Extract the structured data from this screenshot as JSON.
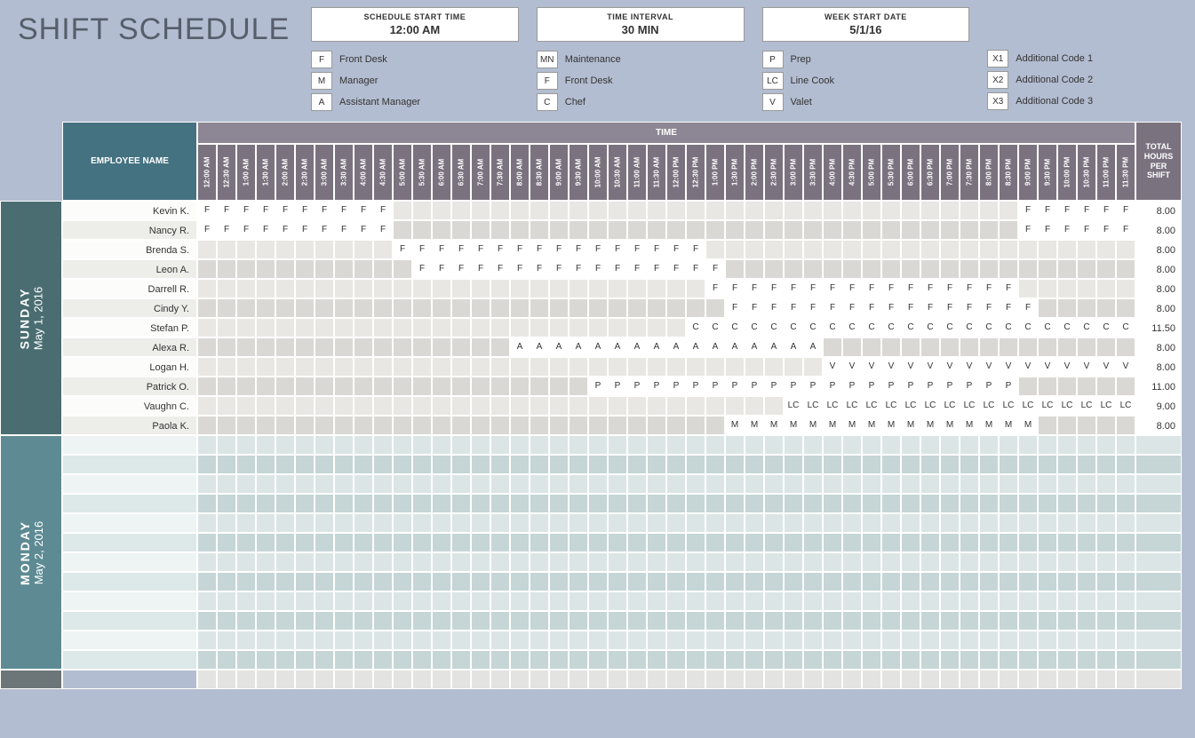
{
  "title": "SHIFT SCHEDULE",
  "info": [
    {
      "label": "SCHEDULE START TIME",
      "value": "12:00 AM"
    },
    {
      "label": "TIME INTERVAL",
      "value": "30 MIN"
    },
    {
      "label": "WEEK START DATE",
      "value": "5/1/16"
    }
  ],
  "legend": [
    [
      {
        "code": "F",
        "text": "Front Desk"
      },
      {
        "code": "M",
        "text": "Manager"
      },
      {
        "code": "A",
        "text": "Assistant Manager"
      }
    ],
    [
      {
        "code": "MN",
        "text": "Maintenance"
      },
      {
        "code": "F",
        "text": "Front Desk"
      },
      {
        "code": "C",
        "text": "Chef"
      }
    ],
    [
      {
        "code": "P",
        "text": "Prep"
      },
      {
        "code": "LC",
        "text": "Line Cook"
      },
      {
        "code": "V",
        "text": "Valet"
      }
    ],
    [
      {
        "code": "X1",
        "text": "Additional Code 1"
      },
      {
        "code": "X2",
        "text": "Additional Code 2"
      },
      {
        "code": "X3",
        "text": "Additional Code 3"
      }
    ]
  ],
  "headers": {
    "employee": "EMPLOYEE NAME",
    "time": "TIME",
    "total": "TOTAL HOURS PER SHIFT"
  },
  "time_slots": [
    "12:00 AM",
    "12:30 AM",
    "1:00 AM",
    "1:30 AM",
    "2:00 AM",
    "2:30 AM",
    "3:00 AM",
    "3:30 AM",
    "4:00 AM",
    "4:30 AM",
    "5:00 AM",
    "5:30 AM",
    "6:00 AM",
    "6:30 AM",
    "7:00 AM",
    "7:30 AM",
    "8:00 AM",
    "8:30 AM",
    "9:00 AM",
    "9:30 AM",
    "10:00 AM",
    "10:30 AM",
    "11:00 AM",
    "11:30 AM",
    "12:00 PM",
    "12:30 PM",
    "1:00 PM",
    "1:30 PM",
    "2:00 PM",
    "2:30 PM",
    "3:00 PM",
    "3:30 PM",
    "4:00 PM",
    "4:30 PM",
    "5:00 PM",
    "5:30 PM",
    "6:00 PM",
    "6:30 PM",
    "7:00 PM",
    "7:30 PM",
    "8:00 PM",
    "8:30 PM",
    "9:00 PM",
    "9:30 PM",
    "10:00 PM",
    "10:30 PM",
    "11:00 PM",
    "11:30 PM"
  ],
  "days": [
    {
      "key": "sun",
      "name": "SUNDAY",
      "date": "May 1, 2016",
      "rows": [
        {
          "name": "Kevin K.",
          "total": "8.00",
          "shifts": [
            {
              "code": "F",
              "start": 0,
              "end": 10
            },
            {
              "code": "F",
              "start": 42,
              "end": 48
            }
          ]
        },
        {
          "name": "Nancy R.",
          "total": "8.00",
          "shifts": [
            {
              "code": "F",
              "start": 0,
              "end": 10
            },
            {
              "code": "F",
              "start": 42,
              "end": 48
            }
          ]
        },
        {
          "name": "Brenda S.",
          "total": "8.00",
          "shifts": [
            {
              "code": "F",
              "start": 10,
              "end": 26
            }
          ]
        },
        {
          "name": "Leon A.",
          "total": "8.00",
          "shifts": [
            {
              "code": "F",
              "start": 11,
              "end": 27
            }
          ]
        },
        {
          "name": "Darrell R.",
          "total": "8.00",
          "shifts": [
            {
              "code": "F",
              "start": 26,
              "end": 42
            }
          ]
        },
        {
          "name": "Cindy Y.",
          "total": "8.00",
          "shifts": [
            {
              "code": "F",
              "start": 27,
              "end": 43
            }
          ]
        },
        {
          "name": "Stefan P.",
          "total": "11.50",
          "shifts": [
            {
              "code": "C",
              "start": 25,
              "end": 48
            }
          ]
        },
        {
          "name": "Alexa R.",
          "total": "8.00",
          "shifts": [
            {
              "code": "A",
              "start": 16,
              "end": 32
            }
          ]
        },
        {
          "name": "Logan H.",
          "total": "8.00",
          "shifts": [
            {
              "code": "V",
              "start": 32,
              "end": 48
            }
          ]
        },
        {
          "name": "Patrick O.",
          "total": "11.00",
          "shifts": [
            {
              "code": "P",
              "start": 20,
              "end": 42
            }
          ]
        },
        {
          "name": "Vaughn C.",
          "total": "9.00",
          "shifts": [
            {
              "code": "LC",
              "start": 30,
              "end": 48
            }
          ]
        },
        {
          "name": "Paola K.",
          "total": "8.00",
          "shifts": [
            {
              "code": "M",
              "start": 27,
              "end": 43
            }
          ]
        }
      ]
    },
    {
      "key": "mon",
      "name": "MONDAY",
      "date": "May 2, 2016",
      "rows": [
        {},
        {},
        {},
        {},
        {},
        {},
        {},
        {},
        {},
        {},
        {},
        {}
      ]
    },
    {
      "key": "tue",
      "name": "",
      "date": "",
      "rows": [
        {}
      ]
    }
  ]
}
